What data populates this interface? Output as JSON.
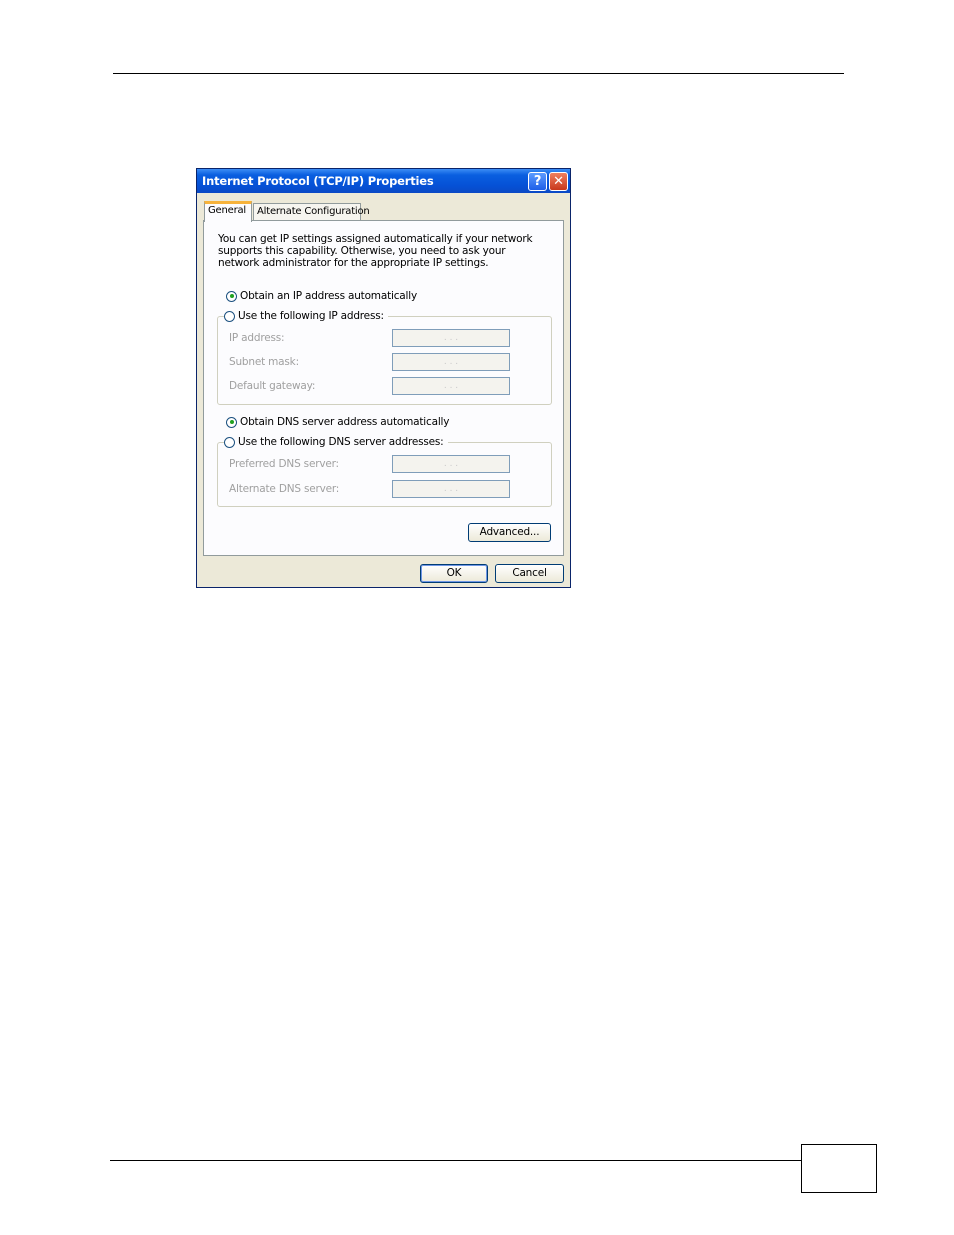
{
  "dialog": {
    "title": "Internet Protocol (TCP/IP) Properties",
    "help_glyph": "?",
    "close_glyph": "✕"
  },
  "tabs": [
    {
      "label": "General"
    },
    {
      "label": "Alternate Configuration"
    }
  ],
  "general": {
    "intro": "You can get IP settings assigned automatically if your network supports this capability. Otherwise, you need to ask your network administrator for the appropriate IP settings.",
    "ip_auto_label": "Obtain an IP address automatically",
    "ip_manual_label": "Use the following IP address:",
    "ip_address_label": "IP address:",
    "subnet_mask_label": "Subnet mask:",
    "default_gateway_label": "Default gateway:",
    "dns_auto_label": "Obtain DNS server address automatically",
    "dns_manual_label": "Use the following DNS server addresses:",
    "preferred_dns_label": "Preferred DNS server:",
    "alternate_dns_label": "Alternate DNS server:",
    "ip_placeholder": ".   .   .",
    "advanced_button": "Advanced..."
  },
  "buttons": {
    "ok": "OK",
    "cancel": "Cancel"
  }
}
